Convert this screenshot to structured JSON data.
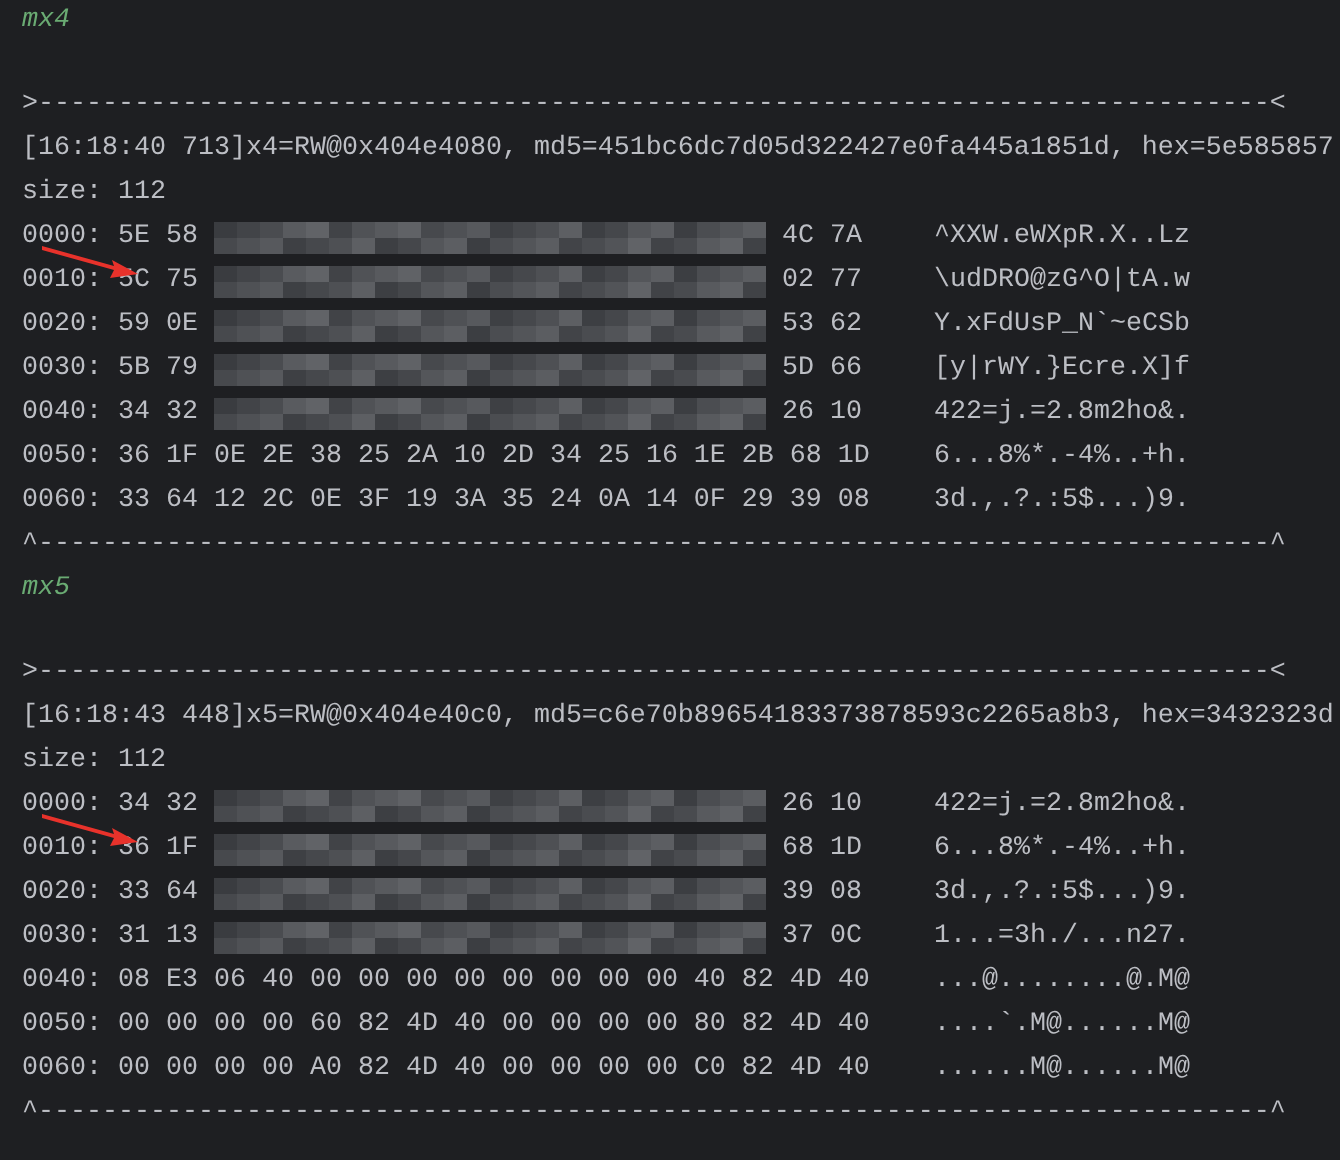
{
  "sections": [
    {
      "label": "mx4",
      "separator_top": ">-----------------------------------------------------------------------------<",
      "header": "[16:18:40 713]x4=RW@0x404e4080, md5=451bc6dc7d05d322427e0fa445a1851d, hex=5e585857",
      "size": "size: 112",
      "rows": [
        {
          "offset": "0000:",
          "hex": [
            "5E",
            "58",
            "4C",
            "7A"
          ],
          "blurred": true,
          "ascii": "^XXW.eWXpR.X..Lz",
          "arrow": false
        },
        {
          "offset": "0010:",
          "hex": [
            "5C",
            "75",
            "02",
            "77"
          ],
          "blurred": true,
          "ascii": "\\udDRO@zG^O|tA.w",
          "arrow": true
        },
        {
          "offset": "0020:",
          "hex": [
            "59",
            "0E",
            "53",
            "62"
          ],
          "blurred": true,
          "ascii": "Y.xFdUsP_N`~eCSb",
          "arrow": false
        },
        {
          "offset": "0030:",
          "hex": [
            "5B",
            "79",
            "5D",
            "66"
          ],
          "blurred": true,
          "ascii": "[y|rWY.}Ecre.X]f",
          "arrow": false
        },
        {
          "offset": "0040:",
          "hex": [
            "34",
            "32",
            "26",
            "10"
          ],
          "blurred": true,
          "ascii": "422=j.=2.8m2ho&.",
          "arrow": false
        },
        {
          "offset": "0050:",
          "hex": [
            "36",
            "1F",
            "0E",
            "2E",
            "38",
            "25",
            "2A",
            "10",
            "2D",
            "34",
            "25",
            "16",
            "1E",
            "2B",
            "68",
            "1D"
          ],
          "blurred": false,
          "ascii": "6...8%*.-4%..+h.",
          "arrow": false
        },
        {
          "offset": "0060:",
          "hex": [
            "33",
            "64",
            "12",
            "2C",
            "0E",
            "3F",
            "19",
            "3A",
            "35",
            "24",
            "0A",
            "14",
            "0F",
            "29",
            "39",
            "08"
          ],
          "blurred": false,
          "ascii": "3d.,.?.:5$...)9.",
          "arrow": false
        }
      ],
      "separator_bottom": "^-----------------------------------------------------------------------------^"
    },
    {
      "label": "mx5",
      "separator_top": ">-----------------------------------------------------------------------------<",
      "header": "[16:18:43 448]x5=RW@0x404e40c0, md5=c6e70b89654183373878593c2265a8b3, hex=3432323d",
      "size": "size: 112",
      "rows": [
        {
          "offset": "0000:",
          "hex": [
            "34",
            "32",
            "26",
            "10"
          ],
          "blurred": true,
          "ascii": "422=j.=2.8m2ho&.",
          "arrow": false
        },
        {
          "offset": "0010:",
          "hex": [
            "36",
            "1F",
            "68",
            "1D"
          ],
          "blurred": true,
          "ascii": "6...8%*.-4%..+h.",
          "arrow": true
        },
        {
          "offset": "0020:",
          "hex": [
            "33",
            "64",
            "39",
            "08"
          ],
          "blurred": true,
          "ascii": "3d.,.?.:5$...)9.",
          "arrow": false
        },
        {
          "offset": "0030:",
          "hex": [
            "31",
            "13",
            "37",
            "0C"
          ],
          "blurred": true,
          "ascii": "1...=3h./...n27.",
          "arrow": false
        },
        {
          "offset": "0040:",
          "hex": [
            "08",
            "E3",
            "06",
            "40",
            "00",
            "00",
            "00",
            "00",
            "00",
            "00",
            "00",
            "00",
            "40",
            "82",
            "4D",
            "40"
          ],
          "blurred": false,
          "ascii": "...@........@.M@",
          "arrow": false
        },
        {
          "offset": "0050:",
          "hex": [
            "00",
            "00",
            "00",
            "00",
            "60",
            "82",
            "4D",
            "40",
            "00",
            "00",
            "00",
            "00",
            "80",
            "82",
            "4D",
            "40"
          ],
          "blurred": false,
          "ascii": "....`.M@......M@",
          "arrow": false
        },
        {
          "offset": "0060:",
          "hex": [
            "00",
            "00",
            "00",
            "00",
            "A0",
            "82",
            "4D",
            "40",
            "00",
            "00",
            "00",
            "00",
            "C0",
            "82",
            "4D",
            "40"
          ],
          "blurred": false,
          "ascii": "......M@......M@",
          "arrow": false
        }
      ],
      "separator_bottom": "^-----------------------------------------------------------------------------^"
    }
  ]
}
